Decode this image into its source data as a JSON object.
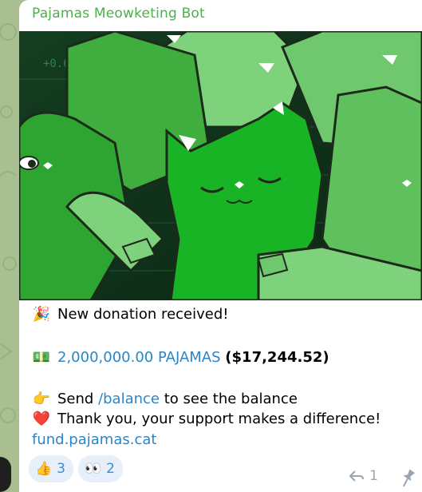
{
  "message": {
    "sender": "Pajamas Meowketing Bot",
    "lines": [
      {
        "icon": "party-popper",
        "emoji": "🎉",
        "text": "New donation received!"
      },
      {
        "icon": "money-bag",
        "emoji": "💵",
        "amount": "2,000,000.00 PAJAMAS",
        "usd": "($17,244.52)"
      },
      {
        "icon": "pointing-hand",
        "emoji": "👉",
        "prefix": "Send ",
        "command": "/balance",
        "suffix": " to see the balance"
      },
      {
        "icon": "red-heart",
        "emoji": "❤️",
        "text": "Thank you, your support makes a difference!"
      },
      {
        "link": "fund.pajamas.cat"
      }
    ]
  },
  "reactions": [
    {
      "icon": "thumbs-up",
      "emoji": "👍",
      "count": "3"
    },
    {
      "icon": "eyes",
      "emoji": "👀",
      "count": "2"
    }
  ],
  "meta": {
    "replies": "1"
  },
  "colors": {
    "sender": "#4fae4e",
    "link": "#2a86c7",
    "bubble": "#ffffff",
    "chat_bg": "#a9bf91"
  }
}
